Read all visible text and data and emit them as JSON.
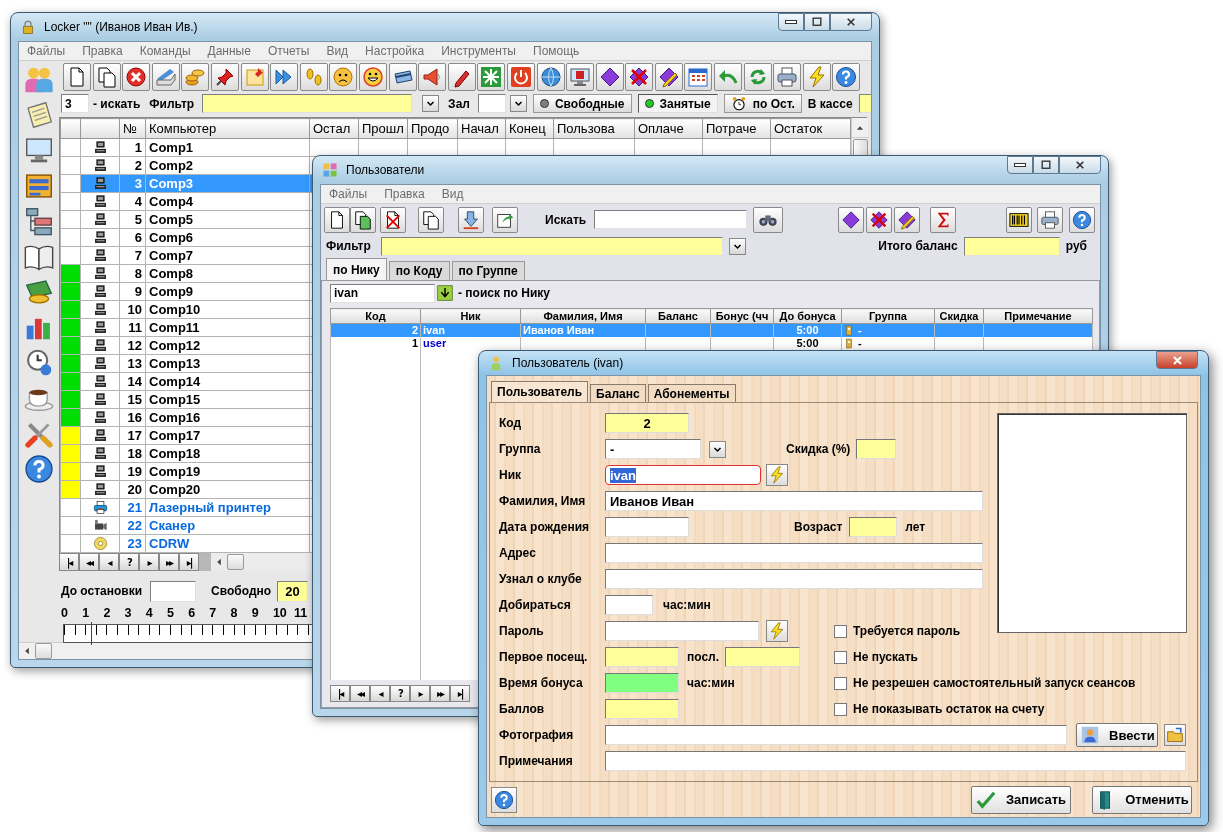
{
  "locker": {
    "title": "Locker  \"\"  (Иванов Иван Ив.)",
    "menu": [
      "Файлы",
      "Правка",
      "Команды",
      "Данные",
      "Отчеты",
      "Вид",
      "Настройка",
      "Инструменты",
      "Помощь"
    ],
    "filter_bar": {
      "count": "3",
      "search_label": "- искать",
      "filter_label": "Фильтр",
      "hall_label": "Зал",
      "toggles": [
        {
          "label": "Свободные",
          "selected": false
        },
        {
          "label": "Занятые",
          "selected": true
        }
      ],
      "remaining_button": "по Ост.",
      "cash_label": "В кассе"
    },
    "table": {
      "columns": [
        "№",
        "Компьютер",
        "Остал",
        "Прошл",
        "Продо",
        "Начал",
        "Конец",
        "Пользова",
        "Оплаче",
        "Потраче",
        "Остаток"
      ],
      "rows": [
        {
          "number": "1",
          "name": "Comp1",
          "kind": "computer",
          "selected": false
        },
        {
          "number": "2",
          "name": "Comp2",
          "kind": "computer",
          "selected": false
        },
        {
          "number": "3",
          "name": "Comp3",
          "kind": "computer",
          "selected": true
        },
        {
          "number": "4",
          "name": "Comp4",
          "kind": "computer",
          "selected": false
        },
        {
          "number": "5",
          "name": "Comp5",
          "kind": "computer",
          "selected": false
        },
        {
          "number": "6",
          "name": "Comp6",
          "kind": "computer",
          "selected": false
        },
        {
          "number": "7",
          "name": "Comp7",
          "kind": "computer",
          "selected": false
        },
        {
          "number": "8",
          "name": "Comp8",
          "kind": "computer",
          "selected": false,
          "color": "#00dd00"
        },
        {
          "number": "9",
          "name": "Comp9",
          "kind": "computer",
          "selected": false,
          "color": "#00dd00"
        },
        {
          "number": "10",
          "name": "Comp10",
          "kind": "computer",
          "selected": false,
          "color": "#00dd00"
        },
        {
          "number": "11",
          "name": "Comp11",
          "kind": "computer",
          "selected": false,
          "color": "#00dd00"
        },
        {
          "number": "12",
          "name": "Comp12",
          "kind": "computer",
          "selected": false,
          "color": "#00dd00"
        },
        {
          "number": "13",
          "name": "Comp13",
          "kind": "computer",
          "selected": false,
          "color": "#00dd00"
        },
        {
          "number": "14",
          "name": "Comp14",
          "kind": "computer",
          "selected": false,
          "color": "#00dd00"
        },
        {
          "number": "15",
          "name": "Comp15",
          "kind": "computer",
          "selected": false,
          "color": "#00dd00"
        },
        {
          "number": "16",
          "name": "Comp16",
          "kind": "computer",
          "selected": false,
          "color": "#00dd00"
        },
        {
          "number": "17",
          "name": "Comp17",
          "kind": "computer",
          "selected": false,
          "color": "#ffff00"
        },
        {
          "number": "18",
          "name": "Comp18",
          "kind": "computer",
          "selected": false,
          "color": "#ffff00"
        },
        {
          "number": "19",
          "name": "Comp19",
          "kind": "computer",
          "selected": false,
          "color": "#ffff00"
        },
        {
          "number": "20",
          "name": "Comp20",
          "kind": "computer",
          "selected": false,
          "color": "#ffff00"
        },
        {
          "number": "21",
          "name": "Лазерный принтер",
          "kind": "printer",
          "selected": false
        },
        {
          "number": "22",
          "name": "Сканер",
          "kind": "scanner",
          "selected": false
        },
        {
          "number": "23",
          "name": "CDRW",
          "kind": "cdrw",
          "selected": false
        }
      ]
    },
    "nav": [
      "|◂",
      "◂◂",
      "◂",
      "?",
      "▸",
      "▸▸",
      "▸|"
    ],
    "stop_label": "До остановки",
    "free_label": "Свободно",
    "free_count": "20",
    "ruler": {
      "labels": [
        "0",
        "1",
        "2",
        "3",
        "4",
        "5",
        "6",
        "7",
        "8",
        "9",
        "10",
        "11"
      ],
      "level": 0.09
    }
  },
  "users": {
    "title": "Пользователи",
    "menu": [
      "Файлы",
      "Правка",
      "Вид"
    ],
    "search_label": "Искать",
    "filter_label": "Фильтр",
    "total_label": "Итого баланс",
    "currency": "руб",
    "tabs": [
      {
        "label": "по Нику",
        "selected": true
      },
      {
        "label": "по Коду",
        "selected": false
      },
      {
        "label": "по Группе",
        "selected": false
      }
    ],
    "search": {
      "value": "ivan",
      "caption": "- поиск по Нику"
    },
    "grid": {
      "columns": [
        "Код",
        "Ник",
        "Фамилия, Имя",
        "Баланс",
        "Бонус (чч",
        "До бонуса",
        "Группа",
        "Скидка",
        "Примечание"
      ],
      "rows": [
        {
          "code": "2",
          "nick": "ivan",
          "name": "Иванов Иван",
          "bonus_until": "5:00",
          "group": "-",
          "selected": true
        },
        {
          "code": "1",
          "nick": "user",
          "bonus_until": "5:00",
          "group": "-",
          "selected": false
        }
      ]
    },
    "nav": [
      "|◂",
      "◂◂",
      "◂",
      "?",
      "▸",
      "▸▸",
      "▸|"
    ]
  },
  "user_dialog": {
    "title": "Пользователь (ivan)",
    "tabs": [
      {
        "label": "Пользователь",
        "selected": true
      },
      {
        "label": "Баланс",
        "selected": false
      },
      {
        "label": "Абонементы",
        "selected": false
      }
    ],
    "fields": {
      "code": {
        "label": "Код",
        "value": "2",
        "color": "#ffff99"
      },
      "group": {
        "label": "Группа",
        "value": "-"
      },
      "discount": {
        "label": "Скидка (%)",
        "color": "#ffff99"
      },
      "nick": {
        "label": "Ник",
        "value": "ivan",
        "focused": true
      },
      "full_name": {
        "label": "Фамилия, Имя",
        "value": "Иванов Иван"
      },
      "birth_date": {
        "label": "Дата рождения"
      },
      "age": {
        "label": "Возраст",
        "unit": "лет",
        "color": "#ffff99"
      },
      "address": {
        "label": "Адрес"
      },
      "heard_about": {
        "label": "Узнал о клубе"
      },
      "travel_time": {
        "label": "Добираться",
        "unit": "час:мин"
      },
      "password": {
        "label": "Пароль"
      },
      "first_visit": {
        "label": "Первое посещ.",
        "color": "#ffff99"
      },
      "last_visit": {
        "label": "посл.",
        "color": "#ffff99"
      },
      "bonus_time": {
        "label": "Время бонуса",
        "unit": "час:мин",
        "color": "#80ff80"
      },
      "points": {
        "label": "Баллов",
        "color": "#ffff99"
      },
      "photo": {
        "label": "Фотография",
        "button": "Ввести"
      },
      "notes": {
        "label": "Примечания"
      }
    },
    "checkboxes": [
      {
        "label": "Требуется пароль",
        "checked": false
      },
      {
        "label": "Не пускать",
        "checked": false
      },
      {
        "label": "Не резрешен самостоятельный запуск сеансов",
        "checked": false
      },
      {
        "label": "Не показывать остаток на счету",
        "checked": false
      }
    ],
    "buttons": [
      {
        "label": "Записать",
        "kind": "save"
      },
      {
        "label": "Отменить",
        "kind": "cancel"
      }
    ]
  }
}
